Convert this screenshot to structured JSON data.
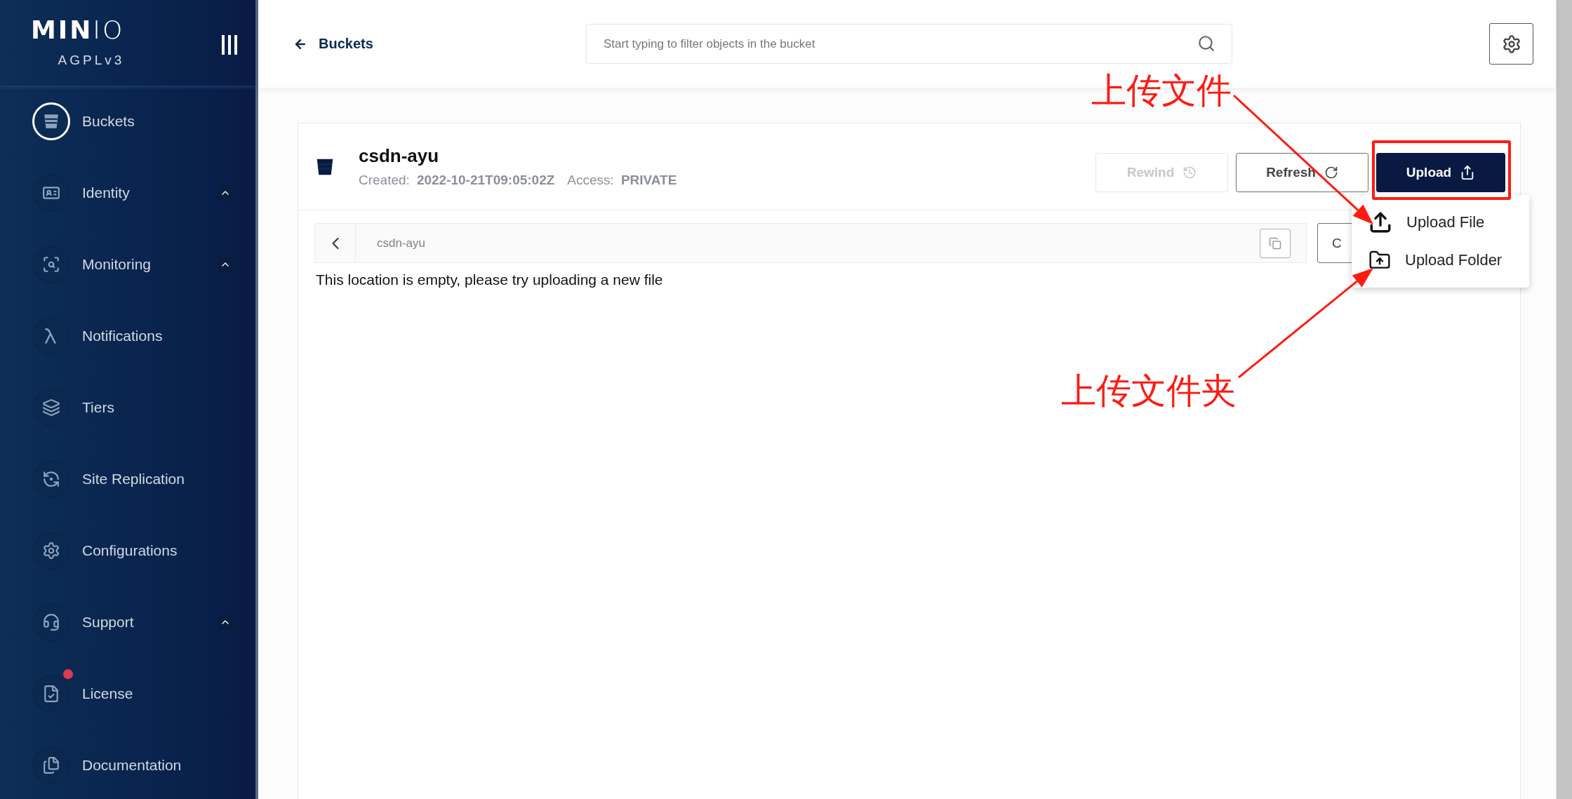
{
  "sidebar": {
    "logo": {
      "bold": "MIN",
      "light": "IO"
    },
    "edition": "AGPLv3",
    "items": [
      {
        "label": "Buckets",
        "kind": "link",
        "selected": true,
        "badge": false
      },
      {
        "label": "Identity",
        "kind": "group",
        "selected": false,
        "badge": false
      },
      {
        "label": "Monitoring",
        "kind": "group",
        "selected": false,
        "badge": false
      },
      {
        "label": "Notifications",
        "kind": "link",
        "selected": false,
        "badge": false
      },
      {
        "label": "Tiers",
        "kind": "link",
        "selected": false,
        "badge": false
      },
      {
        "label": "Site Replication",
        "kind": "link",
        "selected": false,
        "badge": false
      },
      {
        "label": "Configurations",
        "kind": "link",
        "selected": false,
        "badge": false
      },
      {
        "label": "Support",
        "kind": "group",
        "selected": false,
        "badge": false
      },
      {
        "label": "License",
        "kind": "link",
        "selected": false,
        "badge": true
      },
      {
        "label": "Documentation",
        "kind": "link",
        "selected": false,
        "badge": false
      }
    ]
  },
  "top_bar": {
    "back_link": "Buckets",
    "search": {
      "placeholder": "Start typing to filter objects in the bucket"
    }
  },
  "bucket": {
    "name": "csdn-ayu",
    "created_label": "Created:",
    "created": "2022-10-21T09:05:02Z",
    "access_label": "Access:",
    "access": "PRIVATE",
    "buttons": [
      {
        "label": "Rewind",
        "kind": "outline",
        "disabled": true
      },
      {
        "label": "Refresh",
        "kind": "outline",
        "disabled": false
      },
      {
        "label": "Upload",
        "kind": "primary",
        "disabled": false
      }
    ]
  },
  "breadcrumb": {
    "path": "csdn-ayu",
    "partial_button": "C"
  },
  "empty_message": "This location is empty, please try uploading a new file",
  "upload_menu": {
    "items": [
      {
        "label": "Upload File"
      },
      {
        "label": "Upload Folder"
      }
    ]
  },
  "annotations": [
    {
      "text": "上传文件"
    },
    {
      "text": "上传文件夹"
    }
  ]
}
